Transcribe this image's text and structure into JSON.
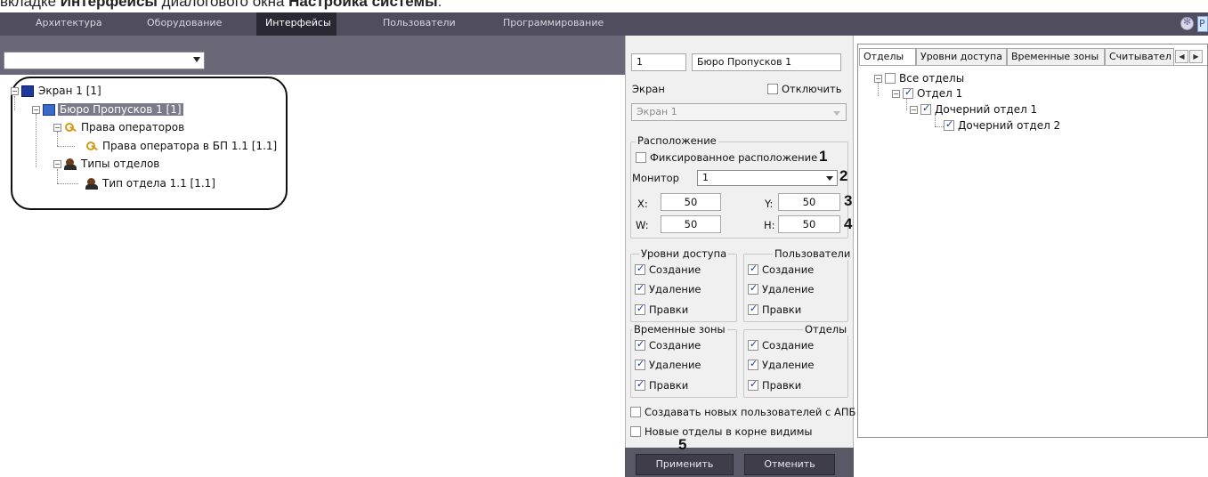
{
  "caption": {
    "pre": "вкладке ",
    "bold1": "Интерфейсы",
    "mid": " диалогового окна ",
    "bold2": "Настройка системы",
    "post": ":"
  },
  "menu": {
    "items": [
      "Архитектура",
      "Оборудование",
      "Интерфейсы",
      "Пользователи",
      "Программирование"
    ],
    "active": "Интерфейсы",
    "right_button": "Р"
  },
  "left": {
    "combo_value": "",
    "tree": [
      {
        "label": "Экран 1 [1]",
        "icon": "monitor-icon"
      },
      {
        "label": "Бюро Пропусков 1 [1]",
        "icon": "panel-icon",
        "selected": true
      },
      {
        "label": "Права операторов",
        "icon": "key-icon"
      },
      {
        "label": "Права оператора в БП 1.1 [1.1]",
        "icon": "key-icon"
      },
      {
        "label": "Типы отделов",
        "icon": "people-icon"
      },
      {
        "label": "Тип отдела 1.1 [1.1]",
        "icon": "people-icon"
      }
    ]
  },
  "form": {
    "id": "1",
    "name": "Бюро Пропусков 1",
    "screen_label": "Экран",
    "disable_label": "Отключить",
    "screen_value": "Экран 1",
    "location_title": "Расположение",
    "fixed_label": "Фиксированное расположение",
    "monitor_label": "Монитор",
    "monitor_value": "1",
    "x_label": "X:",
    "x_value": "50",
    "y_label": "Y:",
    "y_value": "50",
    "w_label": "W:",
    "w_value": "50",
    "h_label": "H:",
    "h_value": "50",
    "annotations": [
      "1",
      "2",
      "3",
      "4",
      "5"
    ],
    "groups": [
      {
        "title": "Уровни доступа",
        "items": [
          "Создание",
          "Удаление",
          "Правки"
        ]
      },
      {
        "title": "Пользователи",
        "items": [
          "Создание",
          "Удаление",
          "Правки"
        ]
      },
      {
        "title": "Временные зоны",
        "items": [
          "Создание",
          "Удаление",
          "Правки"
        ]
      },
      {
        "title": "Отделы",
        "items": [
          "Создание",
          "Удаление",
          "Правки"
        ]
      }
    ],
    "create_apb_label": "Создавать новых пользователей с АПБ",
    "new_depts_root_label": "Новые отделы в корне видимы",
    "apply_label": "Применить",
    "cancel_label": "Отменить"
  },
  "right": {
    "tabs": [
      "Отделы",
      "Уровни доступа",
      "Временные зоны",
      "Считывател"
    ],
    "tree": [
      {
        "label": "Все отделы",
        "checked": false
      },
      {
        "label": "Отдел 1",
        "checked": true
      },
      {
        "label": "Дочерний отдел 1",
        "checked": true
      },
      {
        "label": "Дочерний отдел 2",
        "checked": true
      }
    ]
  }
}
